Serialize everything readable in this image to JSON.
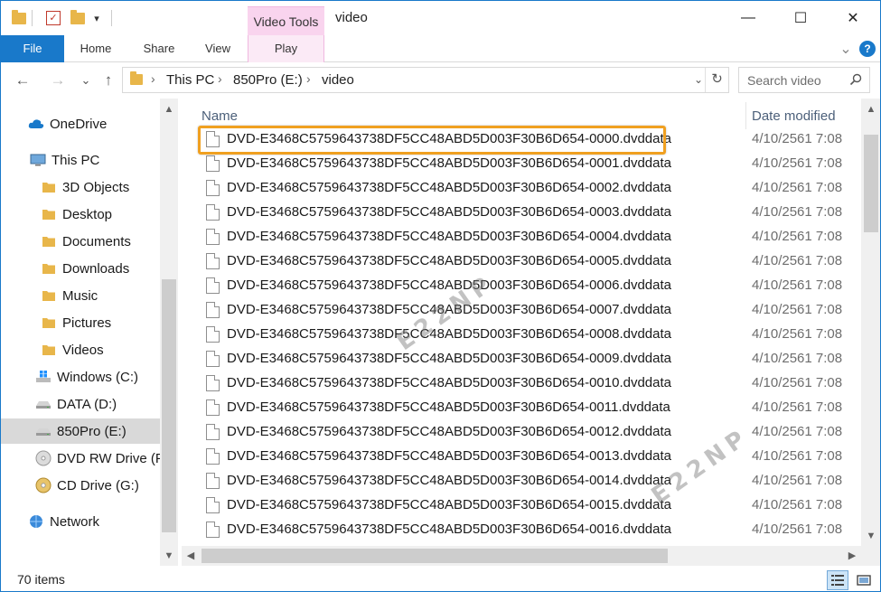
{
  "window": {
    "title": "video",
    "minimize": "—",
    "maximize": "☐",
    "close": "✕"
  },
  "quick_access": {
    "dropdown": "▾"
  },
  "contextual_tab_group": "Video Tools",
  "ribbon": {
    "tabs": [
      "File",
      "Home",
      "Share",
      "View",
      "Play"
    ],
    "collapse": "⌄",
    "help": "?"
  },
  "nav_buttons": {
    "back": "←",
    "forward": "→",
    "recent": "⌄",
    "up": "↑"
  },
  "address": {
    "crumbs": [
      "This PC",
      "850Pro (E:)",
      "video"
    ],
    "sep": "›",
    "dropdown": "⌄",
    "refresh": "↻"
  },
  "search": {
    "placeholder": "Search video"
  },
  "nav_pane": [
    {
      "label": "OneDrive",
      "icon": "cloud-icon"
    },
    {
      "label": "This PC",
      "icon": "computer-icon"
    },
    {
      "label": "3D Objects",
      "icon": "folder-3d-icon"
    },
    {
      "label": "Desktop",
      "icon": "folder-desktop-icon"
    },
    {
      "label": "Documents",
      "icon": "folder-documents-icon"
    },
    {
      "label": "Downloads",
      "icon": "folder-downloads-icon"
    },
    {
      "label": "Music",
      "icon": "folder-music-icon"
    },
    {
      "label": "Pictures",
      "icon": "folder-pictures-icon"
    },
    {
      "label": "Videos",
      "icon": "folder-videos-icon"
    },
    {
      "label": "Windows (C:)",
      "icon": "windows-drive-icon"
    },
    {
      "label": "DATA (D:)",
      "icon": "drive-icon"
    },
    {
      "label": "850Pro (E:)",
      "icon": "drive-icon",
      "selected": true
    },
    {
      "label": "DVD RW Drive (F:)",
      "icon": "dvd-drive-icon"
    },
    {
      "label": "CD Drive (G:)",
      "icon": "cd-drive-icon"
    },
    {
      "label": "Network",
      "icon": "network-icon"
    }
  ],
  "columns": {
    "name": "Name",
    "date": "Date modified"
  },
  "files": [
    {
      "name": "DVD-E3468C5759643738DF5CC48ABD5D003F30B6D654-0000.dvddata",
      "date": "4/10/2561 7:08"
    },
    {
      "name": "DVD-E3468C5759643738DF5CC48ABD5D003F30B6D654-0001.dvddata",
      "date": "4/10/2561 7:08"
    },
    {
      "name": "DVD-E3468C5759643738DF5CC48ABD5D003F30B6D654-0002.dvddata",
      "date": "4/10/2561 7:08"
    },
    {
      "name": "DVD-E3468C5759643738DF5CC48ABD5D003F30B6D654-0003.dvddata",
      "date": "4/10/2561 7:08"
    },
    {
      "name": "DVD-E3468C5759643738DF5CC48ABD5D003F30B6D654-0004.dvddata",
      "date": "4/10/2561 7:08"
    },
    {
      "name": "DVD-E3468C5759643738DF5CC48ABD5D003F30B6D654-0005.dvddata",
      "date": "4/10/2561 7:08"
    },
    {
      "name": "DVD-E3468C5759643738DF5CC48ABD5D003F30B6D654-0006.dvddata",
      "date": "4/10/2561 7:08"
    },
    {
      "name": "DVD-E3468C5759643738DF5CC48ABD5D003F30B6D654-0007.dvddata",
      "date": "4/10/2561 7:08"
    },
    {
      "name": "DVD-E3468C5759643738DF5CC48ABD5D003F30B6D654-0008.dvddata",
      "date": "4/10/2561 7:08"
    },
    {
      "name": "DVD-E3468C5759643738DF5CC48ABD5D003F30B6D654-0009.dvddata",
      "date": "4/10/2561 7:08"
    },
    {
      "name": "DVD-E3468C5759643738DF5CC48ABD5D003F30B6D654-0010.dvddata",
      "date": "4/10/2561 7:08"
    },
    {
      "name": "DVD-E3468C5759643738DF5CC48ABD5D003F30B6D654-0011.dvddata",
      "date": "4/10/2561 7:08"
    },
    {
      "name": "DVD-E3468C5759643738DF5CC48ABD5D003F30B6D654-0012.dvddata",
      "date": "4/10/2561 7:08"
    },
    {
      "name": "DVD-E3468C5759643738DF5CC48ABD5D003F30B6D654-0013.dvddata",
      "date": "4/10/2561 7:08"
    },
    {
      "name": "DVD-E3468C5759643738DF5CC48ABD5D003F30B6D654-0014.dvddata",
      "date": "4/10/2561 7:08"
    },
    {
      "name": "DVD-E3468C5759643738DF5CC48ABD5D003F30B6D654-0015.dvddata",
      "date": "4/10/2561 7:08"
    },
    {
      "name": "DVD-E3468C5759643738DF5CC48ABD5D003F30B6D654-0016.dvddata",
      "date": "4/10/2561 7:08"
    }
  ],
  "highlighted_file_index": 0,
  "status": {
    "item_count": "70 items"
  },
  "watermark": "E22NP",
  "colors": {
    "accent": "#1979ca",
    "video_tools": "#f9d4ee",
    "highlight": "#f0a020",
    "selection": "#d9d9d9"
  }
}
